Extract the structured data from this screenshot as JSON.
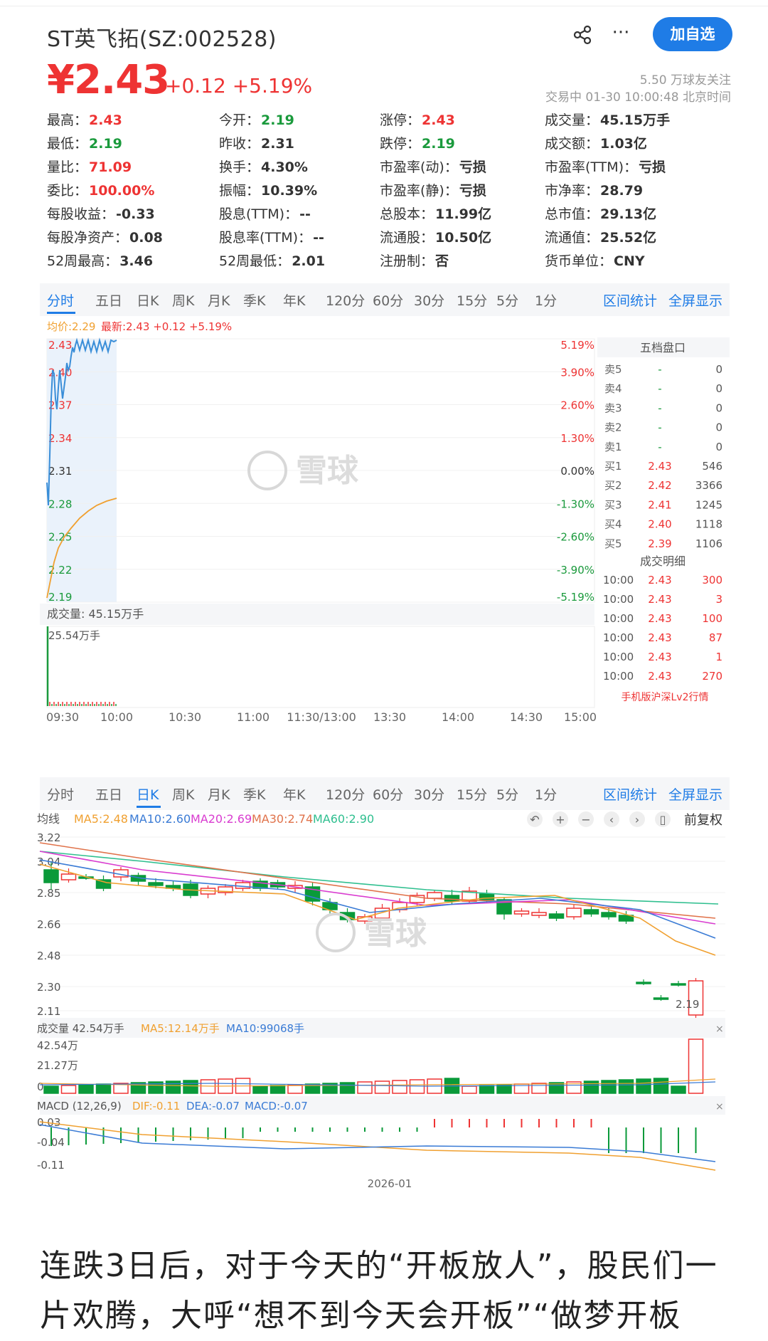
{
  "header": {
    "name": "ST英飞拓(SZ:002528)",
    "add_button": "加自选",
    "more": "···"
  },
  "quote": {
    "price": "¥2.43",
    "change": "+0.12 +5.19%",
    "followers": "5.50 万球友关注",
    "status_time": "交易中 01-30 10:00:48 北京时间",
    "cells": [
      {
        "label": "最高：",
        "value": "2.43",
        "color": "red"
      },
      {
        "label": "今开：",
        "value": "2.19",
        "color": "green"
      },
      {
        "label": "涨停：",
        "value": "2.43",
        "color": "red"
      },
      {
        "label": "成交量：",
        "value": "45.15万手",
        "color": "dark"
      },
      {
        "label": "最低：",
        "value": "2.19",
        "color": "green"
      },
      {
        "label": "昨收：",
        "value": "2.31",
        "color": "dark"
      },
      {
        "label": "跌停：",
        "value": "2.19",
        "color": "green"
      },
      {
        "label": "成交额：",
        "value": "1.03亿",
        "color": "dark"
      },
      {
        "label": "量比：",
        "value": "71.09",
        "color": "red"
      },
      {
        "label": "换手：",
        "value": "4.30%",
        "color": "dark"
      },
      {
        "label": "市盈率(动)：",
        "value": "亏损",
        "color": "dark"
      },
      {
        "label": "市盈率(TTM)：",
        "value": "亏损",
        "color": "dark"
      },
      {
        "label": "委比：",
        "value": "100.00%",
        "color": "red"
      },
      {
        "label": "振幅：",
        "value": "10.39%",
        "color": "dark"
      },
      {
        "label": "市盈率(静)：",
        "value": "亏损",
        "color": "dark"
      },
      {
        "label": "市净率：",
        "value": "28.79",
        "color": "dark"
      },
      {
        "label": "每股收益：",
        "value": "-0.33",
        "color": "dark"
      },
      {
        "label": "股息(TTM)：",
        "value": "--",
        "color": "dark"
      },
      {
        "label": "总股本：",
        "value": "11.99亿",
        "color": "dark"
      },
      {
        "label": "总市值：",
        "value": "29.13亿",
        "color": "dark"
      },
      {
        "label": "每股净资产：",
        "value": "0.08",
        "color": "dark"
      },
      {
        "label": "股息率(TTM)：",
        "value": "--",
        "color": "dark"
      },
      {
        "label": "流通股：",
        "value": "10.50亿",
        "color": "dark"
      },
      {
        "label": "流通值：",
        "value": "25.52亿",
        "color": "dark"
      },
      {
        "label": "52周最高：",
        "value": "3.46",
        "color": "dark"
      },
      {
        "label": "52周最低：",
        "value": "2.01",
        "color": "dark"
      },
      {
        "label": "注册制：",
        "value": "否",
        "color": "dark"
      },
      {
        "label": "货币单位：",
        "value": "CNY",
        "color": "dark"
      }
    ]
  },
  "tabs1": {
    "items": [
      "分时",
      "五日",
      "日K",
      "周K",
      "月K",
      "季K",
      "年K",
      "120分",
      "60分",
      "30分",
      "15分",
      "5分",
      "1分"
    ],
    "active": "分时",
    "interval_stats": "区间统计",
    "fullscreen": "全屏显示"
  },
  "tabs2": {
    "items": [
      "分时",
      "五日",
      "日K",
      "周K",
      "月K",
      "季K",
      "年K",
      "120分",
      "60分",
      "30分",
      "15分",
      "5分",
      "1分"
    ],
    "active": "日K",
    "interval_stats": "区间统计",
    "fullscreen": "全屏显示"
  },
  "intraday": {
    "avg_label": "均价:2.29",
    "latest_label": "最新:2.43 +0.12 +5.19%",
    "price_ticks": [
      "2.43",
      "2.40",
      "2.37",
      "2.34",
      "2.31",
      "2.28",
      "2.25",
      "2.22",
      "2.19"
    ],
    "pct_ticks": [
      "5.19%",
      "3.90%",
      "2.60%",
      "1.30%",
      "0.00%",
      "-1.30%",
      "-2.60%",
      "-3.90%",
      "-5.19%"
    ],
    "volume_label": "成交量: 45.15万手",
    "volume_max": "25.54万手",
    "time_ticks": [
      "09:30",
      "10:00",
      "10:30",
      "11:00",
      "11:30/13:00",
      "13:30",
      "14:00",
      "14:30",
      "15:00"
    ],
    "watermark": "雪球",
    "order_book": {
      "title": "五档盘口",
      "rows": [
        {
          "label": "卖5",
          "price": "-",
          "vol": "0"
        },
        {
          "label": "卖4",
          "price": "-",
          "vol": "0"
        },
        {
          "label": "卖3",
          "price": "-",
          "vol": "0"
        },
        {
          "label": "卖2",
          "price": "-",
          "vol": "0"
        },
        {
          "label": "卖1",
          "price": "-",
          "vol": "0"
        },
        {
          "label": "买1",
          "price": "2.43",
          "vol": "546"
        },
        {
          "label": "买2",
          "price": "2.42",
          "vol": "3366"
        },
        {
          "label": "买3",
          "price": "2.41",
          "vol": "1245"
        },
        {
          "label": "买4",
          "price": "2.40",
          "vol": "1118"
        },
        {
          "label": "买5",
          "price": "2.39",
          "vol": "1106"
        }
      ],
      "detail_title": "成交明细",
      "details": [
        {
          "time": "10:00",
          "price": "2.43",
          "vol": "300"
        },
        {
          "time": "10:00",
          "price": "2.43",
          "vol": "3"
        },
        {
          "time": "10:00",
          "price": "2.43",
          "vol": "100"
        },
        {
          "time": "10:00",
          "price": "2.43",
          "vol": "87"
        },
        {
          "time": "10:00",
          "price": "2.43",
          "vol": "1"
        },
        {
          "time": "10:00",
          "price": "2.43",
          "vol": "270"
        }
      ],
      "lv2_link": "手机版沪深Lv2行情"
    }
  },
  "kline": {
    "ma_title": "均线",
    "ma_labels": [
      {
        "text": "MA5:2.48",
        "color": "#f0a030"
      },
      {
        "text": "MA10:2.60",
        "color": "#3a7bd5"
      },
      {
        "text": "MA20:2.69",
        "color": "#d93cd0"
      },
      {
        "text": "MA30:2.74",
        "color": "#e0724a"
      },
      {
        "text": "MA60:2.90",
        "color": "#2fbf8f"
      }
    ],
    "adjust": "前复权",
    "y_ticks": [
      "3.22",
      "3.04",
      "2.85",
      "2.66",
      "2.48",
      "2.30",
      "2.11"
    ],
    "low_label": "2.19",
    "volume_title": "成交量 42.54万手",
    "vol_ma5": "MA5:12.14万手",
    "vol_ma10": "MA10:99068手",
    "vol_ticks": [
      "42.54万",
      "21.27万",
      "0"
    ],
    "macd_title": "MACD (12,26,9)",
    "dif": "DIF:-0.11",
    "dea": "DEA:-0.07",
    "macd": "MACD:-0.07",
    "macd_ticks": [
      "0.03",
      "-0.04",
      "-0.11"
    ],
    "x_label": "2026-01"
  },
  "caption": "连跌3日后，对于今天的“开板放人”，股民们一片欢腾，大呼“想不到今天会开板”“做梦开板"
}
